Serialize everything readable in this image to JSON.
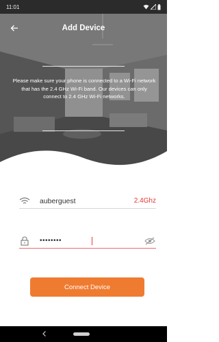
{
  "status_bar": {
    "time": "11:01",
    "icons": [
      "wifi-icon",
      "signal-icon",
      "battery-icon"
    ]
  },
  "app_bar": {
    "title": "Add Device",
    "back_icon": "back-arrow-icon"
  },
  "notice": {
    "text": "Please make sure your phone is connected to a Wi-Fi network that has the 2.4 GHz Wi-Fi band. Our devices can only connect to 2.4 GHz Wi-Fi networks."
  },
  "wifi_row": {
    "icon": "wifi-icon",
    "ssid": "auberguest",
    "band": "2.4Ghz"
  },
  "password_row": {
    "icon": "lock-icon",
    "value": "••••••••",
    "toggle_icon": "eye-off-icon"
  },
  "connect_button": {
    "label": "Connect Device"
  },
  "nav_bar": {
    "icons": [
      "nav-back-icon",
      "nav-home-pill"
    ]
  },
  "colors": {
    "accent": "#ef7b31",
    "band_text": "#e53935",
    "active_underline": "#ea6a73"
  }
}
